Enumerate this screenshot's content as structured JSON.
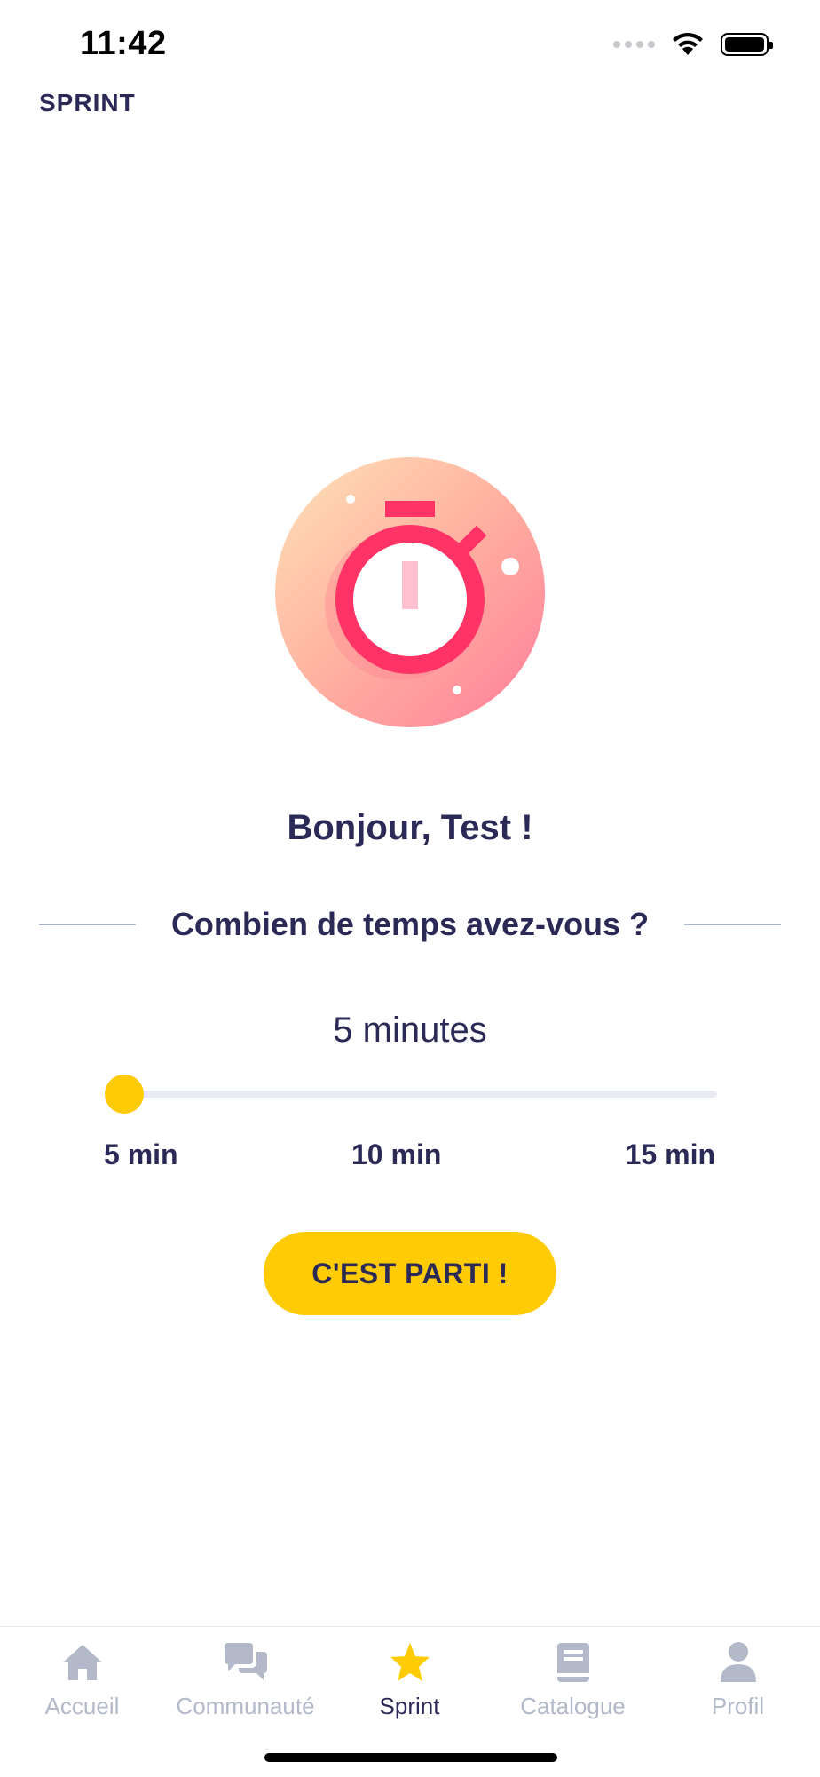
{
  "status_bar": {
    "time": "11:42"
  },
  "header": {
    "title": "SPRINT"
  },
  "main": {
    "greeting": "Bonjour, Test !",
    "question": "Combien de temps avez-vous ?",
    "duration_value": "5 minutes",
    "slider": {
      "value_min": 5,
      "min": 5,
      "max": 15,
      "unit": "min"
    },
    "tick_labels": [
      "5 min",
      "10 min",
      "15 min"
    ],
    "start_button": "C'EST PARTI !"
  },
  "tab_bar": {
    "items": [
      {
        "label": "Accueil",
        "icon": "home-icon",
        "active": false
      },
      {
        "label": "Communauté",
        "icon": "chat-bubbles-icon",
        "active": false
      },
      {
        "label": "Sprint",
        "icon": "star-icon",
        "active": true
      },
      {
        "label": "Catalogue",
        "icon": "book-icon",
        "active": false
      },
      {
        "label": "Profil",
        "icon": "person-icon",
        "active": false
      }
    ]
  },
  "colors": {
    "accent": "#ffcb05",
    "text_primary": "#2b2a57",
    "tab_inactive": "#b3b9c9",
    "stopwatch": "#ff3366"
  }
}
